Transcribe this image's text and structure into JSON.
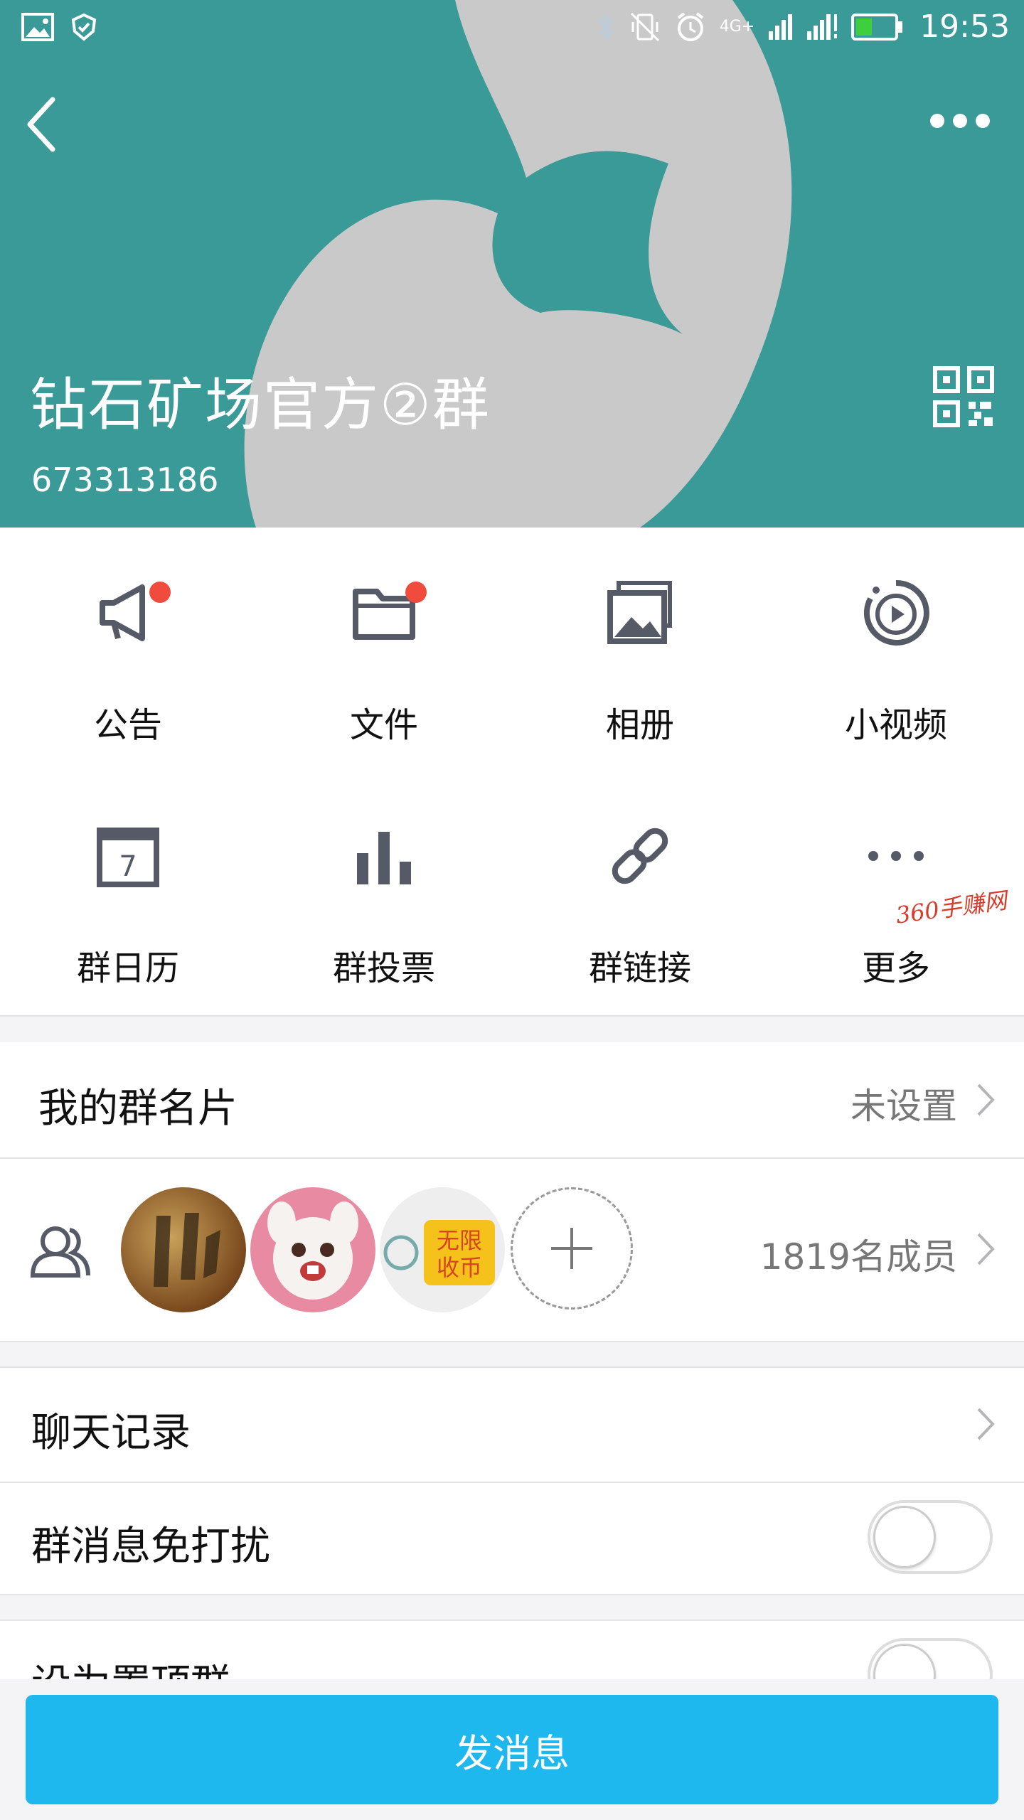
{
  "status_bar": {
    "time": "19:53",
    "network": "4G+"
  },
  "header": {
    "group_name": "钻石矿场官方②群",
    "group_id": "673313186"
  },
  "features": [
    {
      "label": "公告",
      "icon": "megaphone-icon",
      "badge": true
    },
    {
      "label": "文件",
      "icon": "folder-icon",
      "badge": true
    },
    {
      "label": "相册",
      "icon": "album-icon",
      "badge": false
    },
    {
      "label": "小视频",
      "icon": "video-icon",
      "badge": false
    },
    {
      "label": "群日历",
      "icon": "calendar-icon",
      "calendar_day": "7",
      "badge": false
    },
    {
      "label": "群投票",
      "icon": "vote-icon",
      "badge": false
    },
    {
      "label": "群链接",
      "icon": "link-icon",
      "badge": false
    },
    {
      "label": "更多",
      "icon": "more-dots-icon",
      "badge": false
    }
  ],
  "watermark": "360手赚网",
  "group_card": {
    "label": "我的群名片",
    "value": "未设置"
  },
  "members": {
    "count_label": "1819名成员",
    "avatar3_text": "无限\n收币"
  },
  "chat_history": {
    "label": "聊天记录"
  },
  "mute": {
    "label": "群消息免打扰",
    "on": false
  },
  "pin": {
    "label": "设为置顶群",
    "on": false
  },
  "send_button": {
    "label": "发消息"
  },
  "colors": {
    "hero": "#3a9a97",
    "accent": "#1fb8ee",
    "badge": "#f04b3c",
    "icon": "#555a66"
  }
}
